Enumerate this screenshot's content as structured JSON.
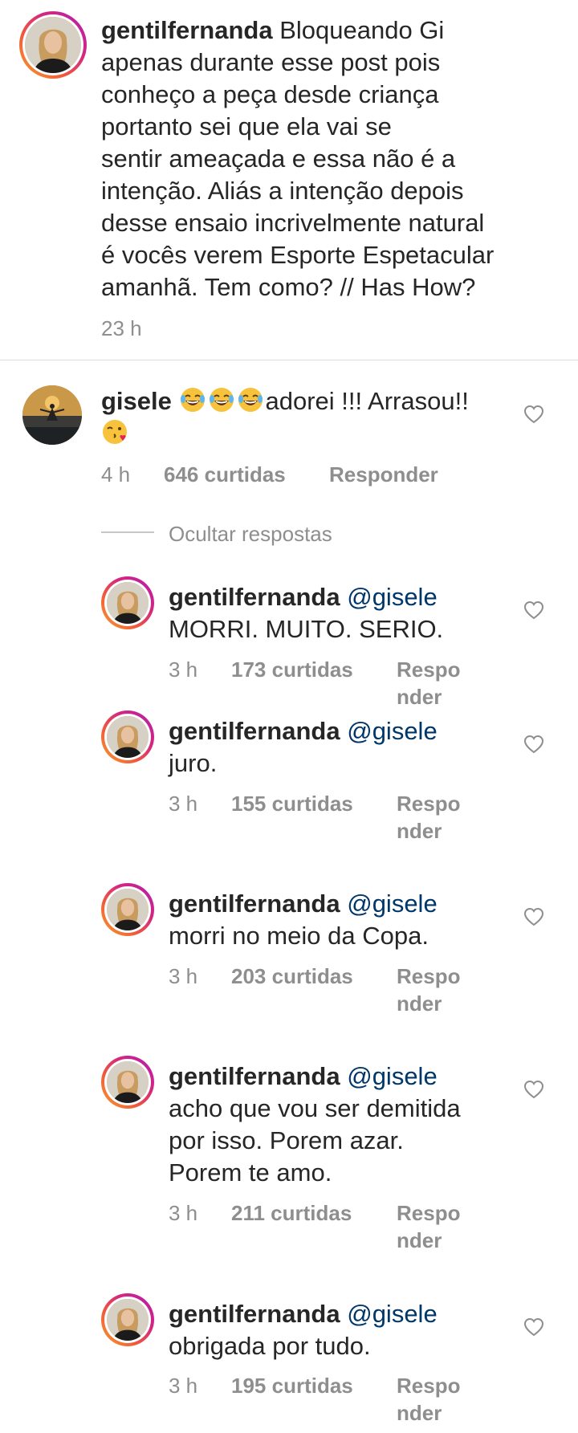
{
  "post_caption": {
    "username": "gentilfernanda",
    "text_lines": [
      " Bloqueando Gi",
      "apenas durante esse post pois",
      "conheço a peça desde criança",
      "portanto sei que ela vai se",
      "sentir ameaçada e essa não é a",
      "intenção. Aliás a intenção depois",
      "desse ensaio incrivelmente natural",
      "é vocês verem Esporte Espetacular",
      "amanhã. Tem como? // Has How?"
    ],
    "time": "23 h"
  },
  "comment": {
    "username": "gisele",
    "text": "adorei !!! Arrasou!!",
    "emoji_laugh": "laughing-with-tears-emoji",
    "emoji_kiss": "face-blowing-kiss-emoji",
    "time": "4 h",
    "likes": "646 curtidas",
    "reply": "Responder"
  },
  "hide_replies": "Ocultar respostas",
  "replies": [
    {
      "username": "gentilfernanda",
      "mention": "@gisele",
      "lines": [
        "MORRI. MUITO. SERIO."
      ],
      "time": "3 h",
      "likes": "173 curtidas",
      "reply_1": "Respo",
      "reply_2": "nder"
    },
    {
      "username": "gentilfernanda",
      "mention": "@gisele",
      "lines": [
        "juro."
      ],
      "time": "3 h",
      "likes": "155 curtidas",
      "reply_1": "Respo",
      "reply_2": "nder"
    },
    {
      "username": "gentilfernanda",
      "mention": "@gisele",
      "lines": [
        "morri no meio da Copa."
      ],
      "time": "3 h",
      "likes": "203 curtidas",
      "reply_1": "Respo",
      "reply_2": "nder"
    },
    {
      "username": "gentilfernanda",
      "mention": "@gisele",
      "lines": [
        "acho que vou ser demitida",
        "por isso. Porem azar.",
        "Porem te amo."
      ],
      "time": "3 h",
      "likes": "211 curtidas",
      "reply_1": "Respo",
      "reply_2": "nder"
    },
    {
      "username": "gentilfernanda",
      "mention": "@gisele",
      "lines": [
        "obrigada por tudo."
      ],
      "time": "3 h",
      "likes": "195 curtidas",
      "reply_1": "Respo",
      "reply_2": "nder"
    }
  ],
  "icons": {
    "like": "heart-outline-icon",
    "avatar_ring_colors": [
      "#f9a02c",
      "#f05a3b",
      "#d5267f",
      "#b21fb0"
    ]
  },
  "colors": {
    "text": "#262626",
    "secondary": "#8e8e8e",
    "mention": "#00376b",
    "divider": "#dbdbdb"
  }
}
